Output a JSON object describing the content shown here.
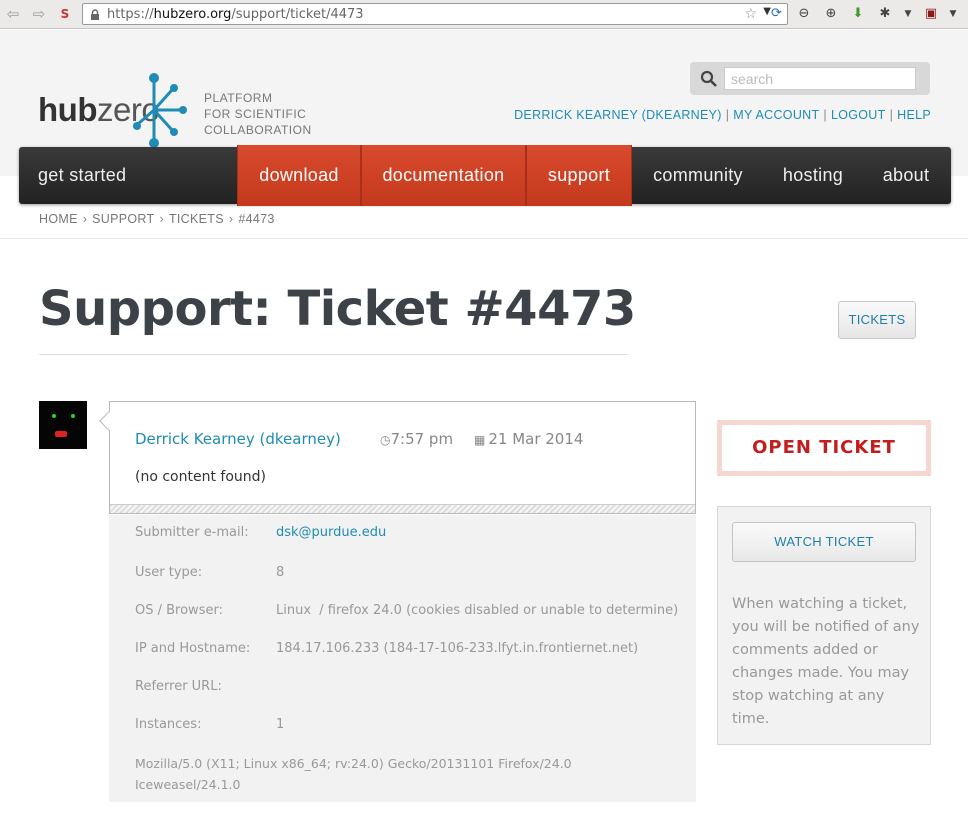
{
  "browser": {
    "url_prefix": "https://",
    "url_host": "hubzero.org",
    "url_path": "/support/ticket/4473"
  },
  "header": {
    "logo_hub": "hub",
    "logo_zero": "zero",
    "tagline": [
      "PLATFORM",
      "FOR SCIENTIFIC",
      "COLLABORATION"
    ],
    "search_placeholder": "search",
    "user_links": [
      "DERRICK KEARNEY (DKEARNEY)",
      "MY ACCOUNT",
      "LOGOUT",
      "HELP"
    ]
  },
  "nav": {
    "items": [
      "get started",
      "download",
      "documentation",
      "support",
      "community",
      "hosting",
      "about"
    ]
  },
  "breadcrumb": [
    "HOME",
    "SUPPORT",
    "TICKETS",
    "#4473"
  ],
  "page": {
    "title": "Support: Ticket #4473",
    "tickets_button": "TICKETS"
  },
  "comment": {
    "author": "Derrick Kearney (dkearney)",
    "time": "7:57 pm",
    "date": "21 Mar 2014",
    "body": "(no content found)"
  },
  "details": {
    "submitter_email_label": "Submitter e-mail:",
    "submitter_email": "dsk@purdue.edu",
    "user_type_label": "User type:",
    "user_type": "8",
    "os_label": "OS / Browser:",
    "os": "Linux  / firefox 24.0 (cookies disabled or unable to determine)",
    "ip_label": "IP and Hostname:",
    "ip": "184.17.106.233 (184-17-106-233.lfyt.in.frontiernet.net)",
    "referrer_label": "Referrer URL:",
    "referrer": "",
    "instances_label": "Instances:",
    "instances": "1",
    "user_agent_line1": "Mozilla/5.0 (X11; Linux x86_64; rv:24.0) Gecko/20131101 Firefox/24.0",
    "user_agent_line2": "Iceweasel/24.1.0"
  },
  "sidebar": {
    "status": "OPEN TICKET",
    "watch_button": "WATCH TICKET",
    "watch_text": "When watching a ticket, you will be notified of any comments added or changes made. You may stop watching at any time."
  },
  "colors": {
    "accent": "#1e8cb4",
    "nav_active": "#d1401f",
    "status": "#c21e1e"
  }
}
